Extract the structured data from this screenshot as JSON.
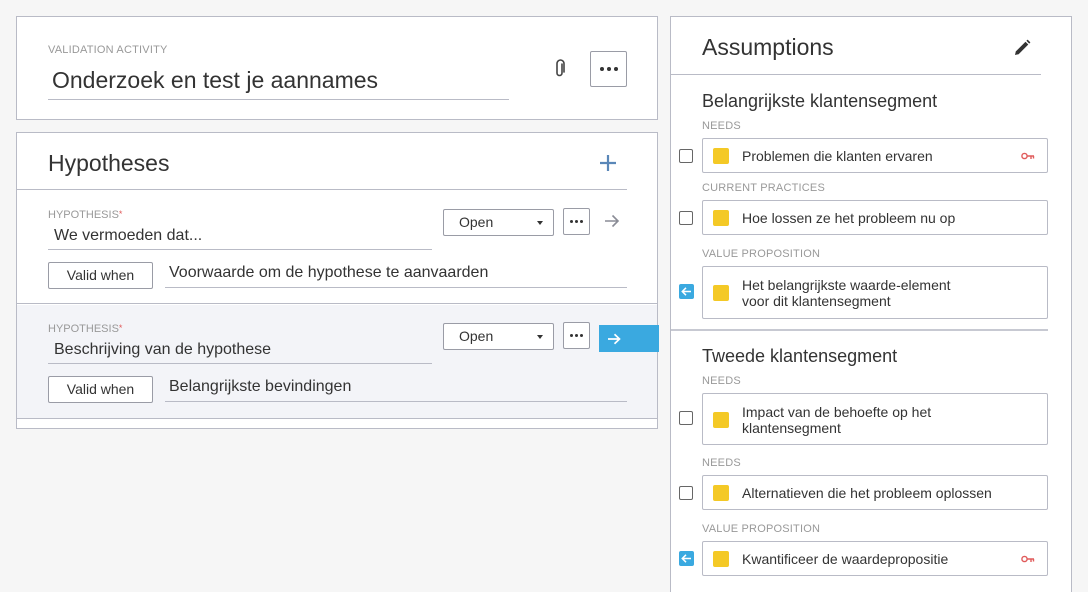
{
  "activity": {
    "label": "VALIDATION ACTIVITY",
    "title": "Onderzoek en test je aannames",
    "attach_icon": "paperclip-icon",
    "more_icon": "more-dots-icon"
  },
  "hypotheses": {
    "title": "Hypotheses",
    "add_icon": "plus-icon",
    "items": [
      {
        "label": "HYPOTHESIS",
        "required_mark": "*",
        "text": "We vermoeden dat...",
        "status": "Open",
        "valid_label": "Valid when",
        "valid_text": "Voorwaarde om de hypothese te aanvaarden",
        "selected": false
      },
      {
        "label": "HYPOTHESIS",
        "required_mark": "*",
        "text": "Beschrijving van de hypothese",
        "status": "Open",
        "valid_label": "Valid when",
        "valid_text": "Belangrijkste bevindingen",
        "selected": true
      }
    ]
  },
  "assumptions": {
    "title": "Assumptions",
    "edit_icon": "pencil-icon",
    "segments": [
      {
        "title": "Belangrijkste klantensegment",
        "groups": [
          {
            "category": "NEEDS",
            "text": "Problemen die klanten ervaren",
            "checked": false,
            "key": true
          },
          {
            "category": "CURRENT PRACTICES",
            "text": "Hoe lossen ze het probleem nu op",
            "checked": false,
            "key": false
          },
          {
            "category": "VALUE PROPOSITION",
            "text_line1": "Het belangrijkste waarde-element",
            "text_line2": "voor dit klantensegment",
            "checked": true,
            "key": false
          }
        ]
      },
      {
        "title": "Tweede klantensegment",
        "groups": [
          {
            "category": "NEEDS",
            "text_line1": "Impact van de behoefte op het",
            "text_line2": "klantensegment",
            "checked": false,
            "key": false
          },
          {
            "category": "NEEDS",
            "text": "Alternatieven die het probleem oplossen",
            "checked": false,
            "key": false
          },
          {
            "category": "VALUE PROPOSITION",
            "text": "Kwantificeer de waardepropositie",
            "checked": true,
            "key": true
          }
        ]
      }
    ],
    "colors": {
      "sticky": "#f4c926",
      "accent": "#3aa9e0",
      "key": "#e05b5b"
    }
  }
}
